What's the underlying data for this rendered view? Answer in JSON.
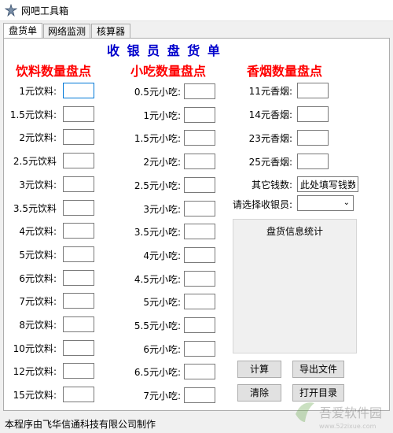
{
  "window": {
    "title": "网吧工具箱"
  },
  "tabs": [
    {
      "label": "盘货单",
      "active": true
    },
    {
      "label": "网络监测",
      "active": false
    },
    {
      "label": "核算器",
      "active": false
    }
  ],
  "heading": "收 银 员 盘 货 单",
  "columns": {
    "drinks": "饮料数量盘点",
    "snacks": "小吃数量盘点",
    "cigarettes": "香烟数量盘点"
  },
  "drinks": [
    {
      "label": "1元饮料:",
      "value": ""
    },
    {
      "label": "1.5元饮料:",
      "value": ""
    },
    {
      "label": "2元饮料:",
      "value": ""
    },
    {
      "label": "2.5元饮料",
      "value": ""
    },
    {
      "label": "3元饮料:",
      "value": ""
    },
    {
      "label": "3.5元饮料",
      "value": ""
    },
    {
      "label": "4元饮料:",
      "value": ""
    },
    {
      "label": "5元饮料:",
      "value": ""
    },
    {
      "label": "6元饮料:",
      "value": ""
    },
    {
      "label": "7元饮料:",
      "value": ""
    },
    {
      "label": "8元饮料:",
      "value": ""
    },
    {
      "label": "10元饮料:",
      "value": ""
    },
    {
      "label": "12元饮料:",
      "value": ""
    },
    {
      "label": "15元饮料:",
      "value": ""
    }
  ],
  "snacks": [
    {
      "label": "0.5元小吃:",
      "value": ""
    },
    {
      "label": "1元小吃:",
      "value": ""
    },
    {
      "label": "1.5元小吃:",
      "value": ""
    },
    {
      "label": "2元小吃:",
      "value": ""
    },
    {
      "label": "2.5元小吃:",
      "value": ""
    },
    {
      "label": "3元小吃:",
      "value": ""
    },
    {
      "label": "3.5元小吃:",
      "value": ""
    },
    {
      "label": "4元小吃:",
      "value": ""
    },
    {
      "label": "4.5元小吃:",
      "value": ""
    },
    {
      "label": "5元小吃:",
      "value": ""
    },
    {
      "label": "5.5元小吃:",
      "value": ""
    },
    {
      "label": "6元小吃:",
      "value": ""
    },
    {
      "label": "6.5元小吃:",
      "value": ""
    },
    {
      "label": "7元小吃:",
      "value": ""
    }
  ],
  "cigarettes": [
    {
      "label": "11元香烟:",
      "value": ""
    },
    {
      "label": "14元香烟:",
      "value": ""
    },
    {
      "label": "23元香烟:",
      "value": ""
    },
    {
      "label": "25元香烟:",
      "value": ""
    }
  ],
  "other_money": {
    "label": "其它钱数:",
    "value": "此处填写钱数"
  },
  "cashier": {
    "label": "请选择收银员:",
    "value": ""
  },
  "stats": {
    "title": "盘货信息统计"
  },
  "buttons": {
    "calculate": "计算",
    "export": "导出文件",
    "clear": "清除",
    "open_dir": "打开目录"
  },
  "footer": "本程序由飞华信通科技有限公司制作",
  "watermark": {
    "text": "吾爱软件园",
    "url": "www.52zixue.com"
  }
}
